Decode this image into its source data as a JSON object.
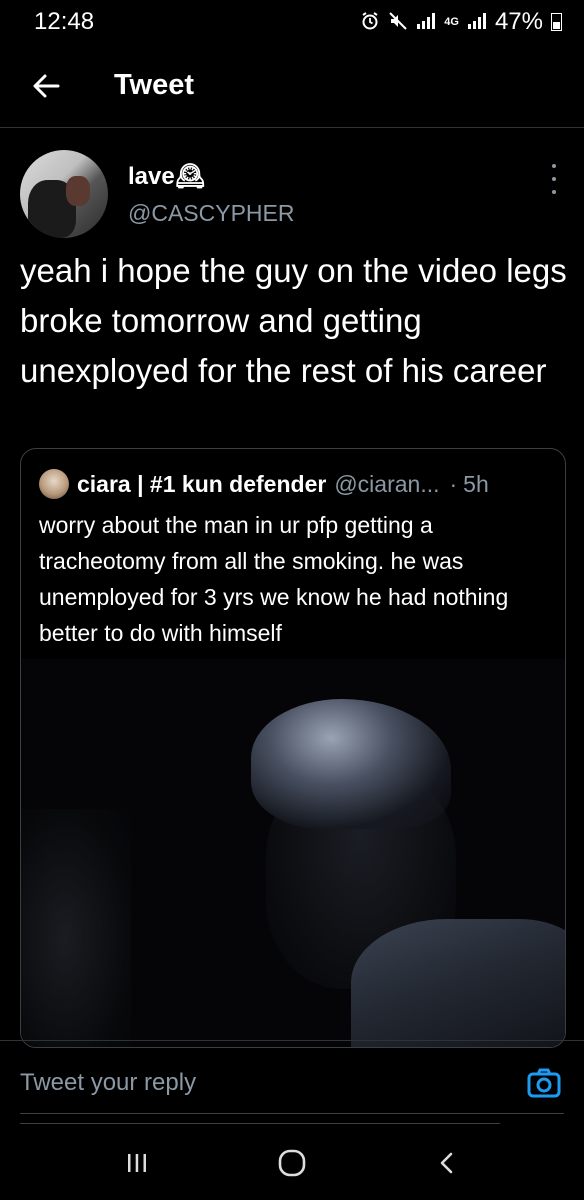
{
  "status_bar": {
    "time": "12:48",
    "network": "4G",
    "battery": "47%"
  },
  "header": {
    "title": "Tweet"
  },
  "tweet": {
    "author_name": "lave🕰",
    "author_handle": "@CASCYPHER",
    "text": "yeah i hope the guy on the video legs broke tomorrow and getting unexployed for the rest of his career"
  },
  "quote": {
    "author_name": "ciara | #1 kun defender",
    "author_handle": "@ciaran...",
    "separator": "·",
    "time": "5h",
    "text": "worry about the man in ur pfp getting a tracheotomy from all the smoking. he was unemployed for 3 yrs we know he had nothing better to do with himself"
  },
  "reply": {
    "placeholder": "Tweet your reply"
  },
  "colors": {
    "background": "#000000",
    "accent": "#1d9bf0",
    "secondary_text": "#8b98a5",
    "divider": "#2f3336"
  },
  "icons": {
    "back": "back-arrow-icon",
    "more": "more-vertical-icon",
    "camera": "camera-icon",
    "alarm": "alarm-icon",
    "mute": "mute-icon",
    "signal": "signal-icon",
    "recents": "recents-icon",
    "home": "home-icon",
    "nav_back": "nav-back-icon"
  }
}
